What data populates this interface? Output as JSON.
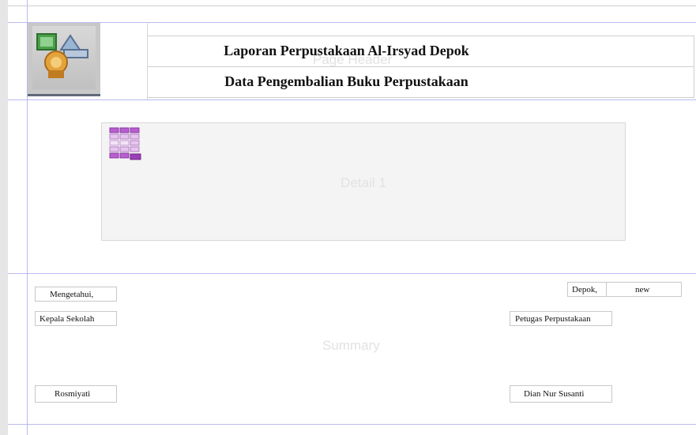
{
  "header": {
    "title": "Laporan Perpustakaan Al-Irsyad Depok",
    "subtitle": "Data Pengembalian Buku Perpustakaan",
    "section_label": "Page Header"
  },
  "detail": {
    "section_label": "Detail 1"
  },
  "summary": {
    "section_label": "Summary",
    "mengetahui": "Mengetahui,",
    "kepala_sekolah": "Kepala Sekolah",
    "kepala_name": "Rosmiyati",
    "location": "Depok,",
    "date_value": "new",
    "petugas": "Petugas Perpustakaan",
    "petugas_name": "Dian Nur Susanti"
  }
}
